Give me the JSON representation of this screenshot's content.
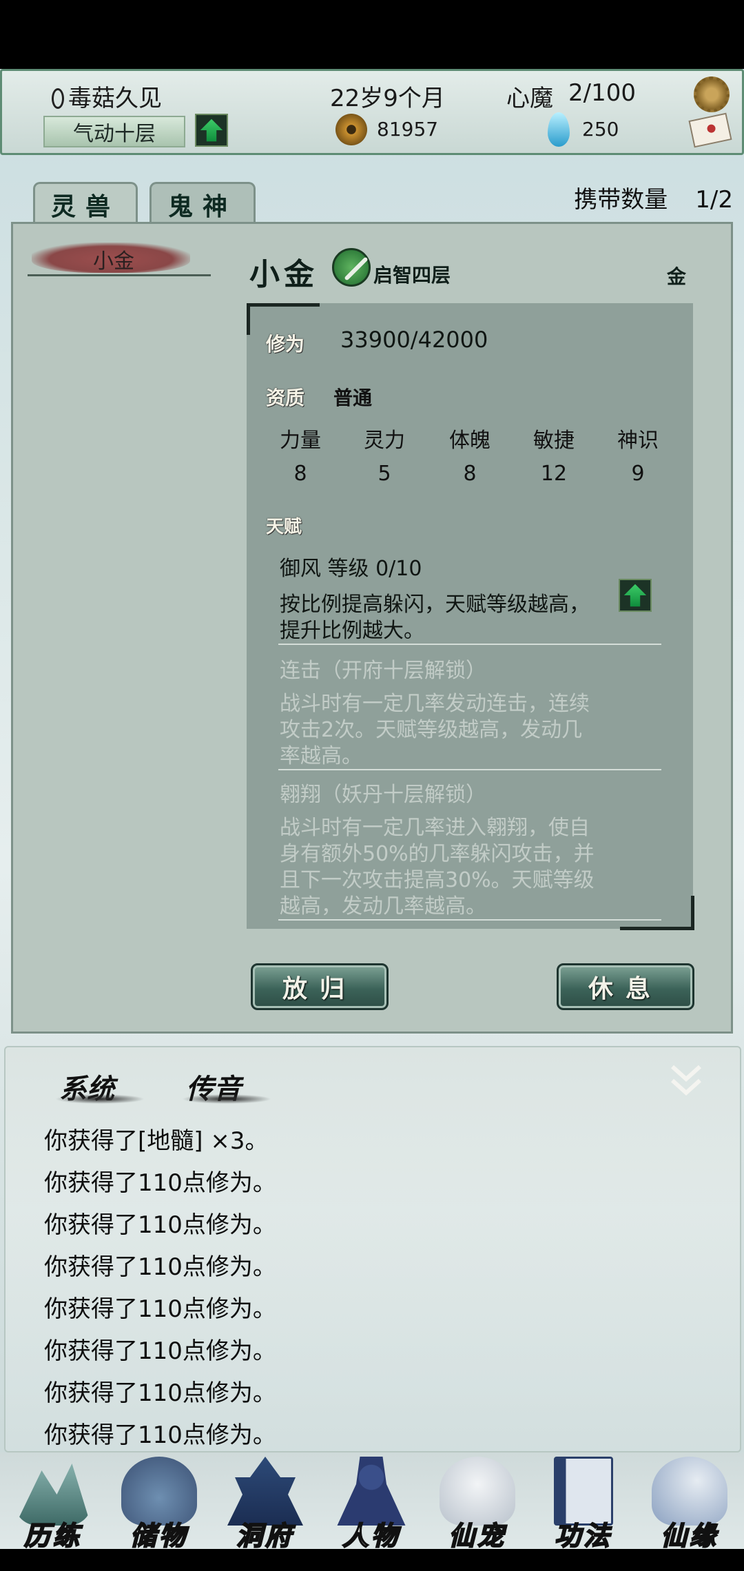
{
  "header": {
    "player_name": "毒菇久见",
    "age": "22岁9个月",
    "demon_label": "心魔",
    "demon_value": "2/100",
    "realm": "气动十层",
    "coins": "81957",
    "spirit_stones": "250"
  },
  "tabs": [
    {
      "label": "灵兽"
    },
    {
      "label": "鬼神"
    }
  ],
  "carry": {
    "label": "携带数量",
    "value": "1/2"
  },
  "pet_list": [
    {
      "label": "小金"
    }
  ],
  "pet": {
    "name": "小金",
    "stage": "启智四层",
    "element": "金",
    "cultivation_label": "修为",
    "cultivation_value": "33900/42000",
    "aptitude_label": "资质",
    "aptitude_value": "普通",
    "stats": [
      {
        "name": "力量",
        "value": "8"
      },
      {
        "name": "灵力",
        "value": "5"
      },
      {
        "name": "体魄",
        "value": "8"
      },
      {
        "name": "敏捷",
        "value": "12"
      },
      {
        "name": "神识",
        "value": "9"
      }
    ],
    "talent_label": "天赋",
    "talents": [
      {
        "title": "御风   等级  0/10",
        "desc1": "按比例提高躲闪，天赋等级越高，",
        "desc2": "提升比例越大。",
        "desc3": ""
      },
      {
        "title": "连击（开府十层解锁）",
        "desc1": "战斗时有一定几率发动连击，连续",
        "desc2": "攻击2次。天赋等级越高，发动几",
        "desc3": "率越高。"
      },
      {
        "title": "翱翔（妖丹十层解锁）",
        "desc1": "战斗时有一定几率进入翱翔，使自",
        "desc2": "身有额外50%的几率躲闪攻击，并",
        "desc3": "且下一次攻击提高30%。天赋等级",
        "desc4": "越高，发动几率越高。"
      }
    ]
  },
  "buttons": {
    "release": "放归",
    "rest": "休息"
  },
  "chat": {
    "tabs": [
      {
        "label": "系统"
      },
      {
        "label": "传音"
      }
    ],
    "lines": [
      "你获得了[地髓] ×3。",
      "你获得了110点修为。",
      "你获得了110点修为。",
      "你获得了110点修为。",
      "你获得了110点修为。",
      "你获得了110点修为。",
      "你获得了110点修为。",
      "你获得了110点修为。"
    ]
  },
  "nav": [
    {
      "label": "历练",
      "icon": "mountain-icon"
    },
    {
      "label": "储物",
      "icon": "pouch-icon"
    },
    {
      "label": "洞府",
      "icon": "pagoda-icon"
    },
    {
      "label": "人物",
      "icon": "person-icon"
    },
    {
      "label": "仙宠",
      "icon": "ghost-pet-icon"
    },
    {
      "label": "功法",
      "icon": "book-icon"
    },
    {
      "label": "仙缘",
      "icon": "crane-icon"
    }
  ]
}
